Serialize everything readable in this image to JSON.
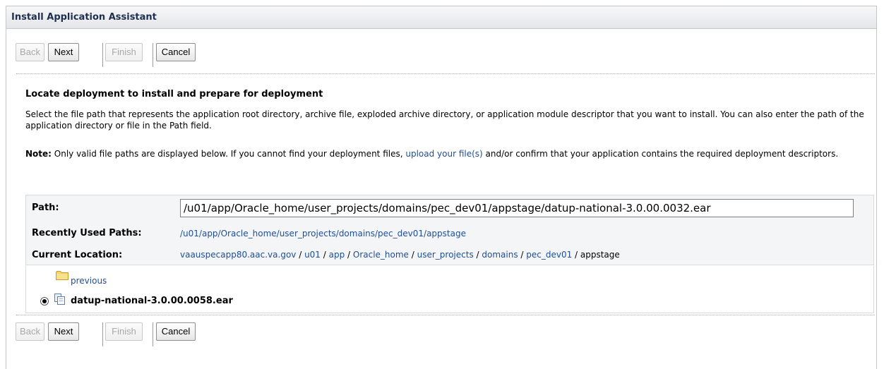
{
  "window": {
    "title": "Install Application Assistant"
  },
  "toolbar": {
    "back_label": "Back",
    "next_label": "Next",
    "finish_label": "Finish",
    "cancel_label": "Cancel"
  },
  "main": {
    "heading": "Locate deployment to install and prepare for deployment",
    "description": "Select the file path that represents the application root directory, archive file, exploded archive directory, or application module descriptor that you want to install. You can also enter the path of the application directory or file in the Path field.",
    "note_label": "Note:",
    "note_text_before": " Only valid file paths are displayed below. If you cannot find your deployment files, ",
    "note_link": "upload your file(s)",
    "note_text_after": " and/or confirm that your application contains the required deployment descriptors."
  },
  "path_panel": {
    "path_label": "Path:",
    "path_value": "/u01/app/Oracle_home/user_projects/domains/pec_dev01/appstage/datup-national-3.0.00.0032.ear",
    "recent_label": "Recently Used Paths:",
    "recent_value": "/u01/app/Oracle_home/user_projects/domains/pec_dev01/appstage",
    "location_label": "Current Location:",
    "location_crumbs": [
      "vaauspecapp80.aac.va.gov",
      "u01",
      "app",
      "Oracle_home",
      "user_projects",
      "domains",
      "pec_dev01"
    ],
    "location_current": "appstage",
    "separator": " / "
  },
  "file_list": {
    "previous_label": "previous",
    "items": [
      {
        "name": "datup-national-3.0.00.0058.ear",
        "selected": true
      }
    ]
  },
  "colors": {
    "link": "#1e4e9a",
    "title_text": "#1f2f4f",
    "panel_bg": "#f4f5f7"
  }
}
